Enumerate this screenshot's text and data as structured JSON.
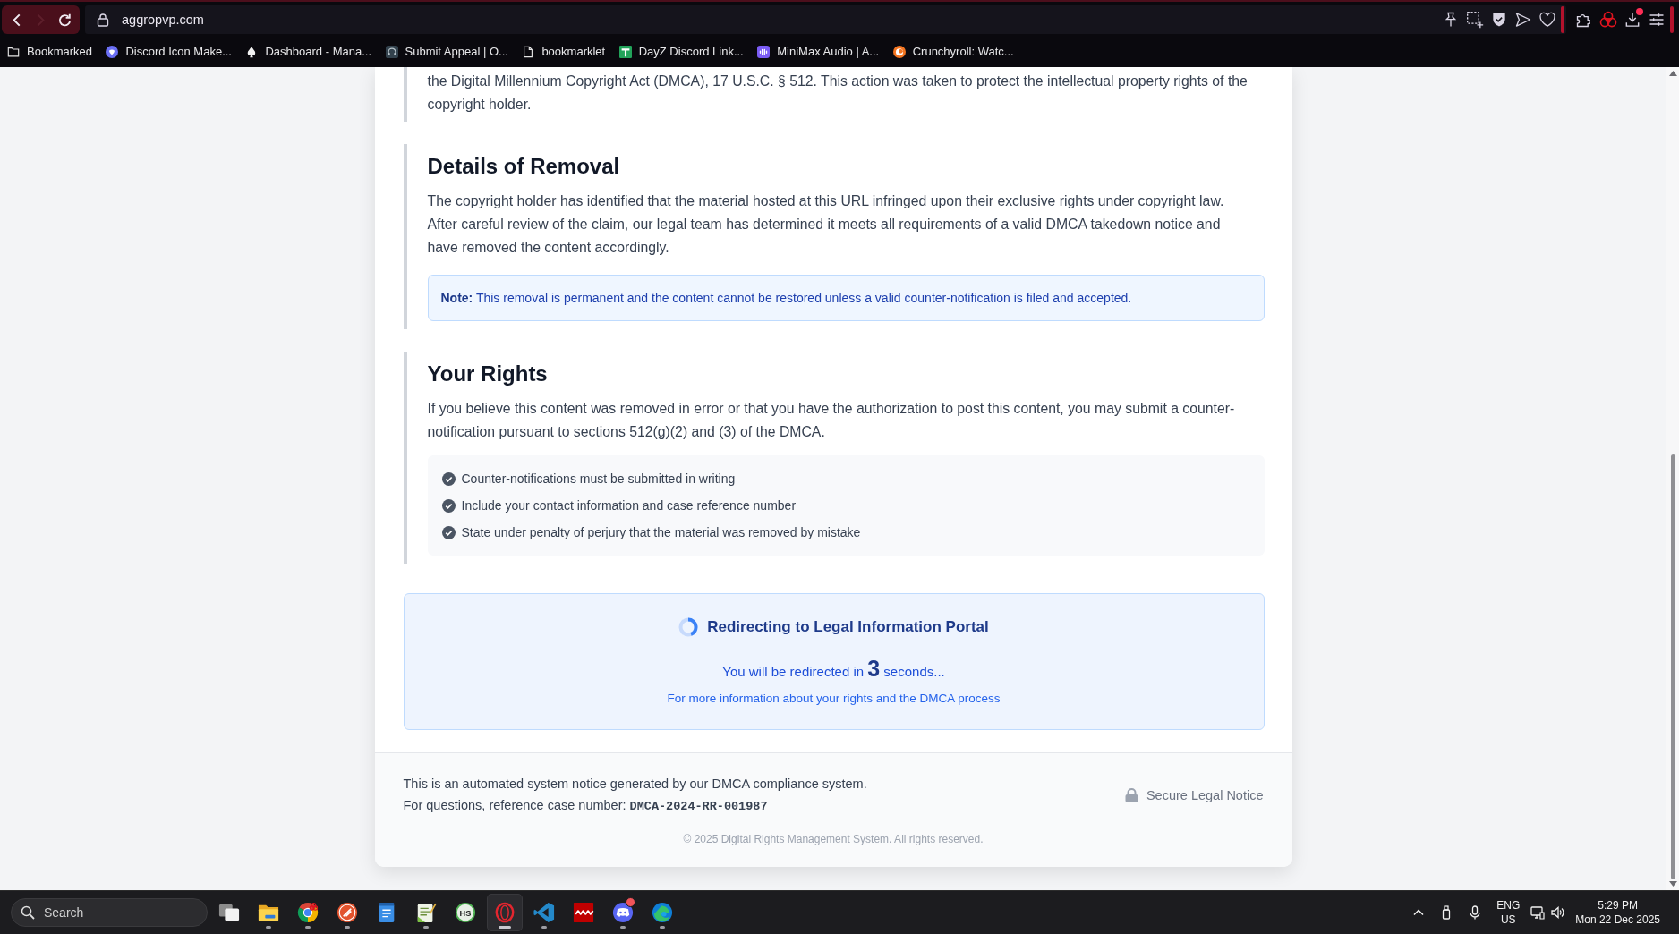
{
  "browser": {
    "nav": [
      {
        "kind": "back",
        "disabled": false
      },
      {
        "kind": "forward",
        "disabled": true
      },
      {
        "kind": "reload",
        "disabled": false
      }
    ],
    "url": "aggropvp.com",
    "download_badge": true,
    "bookmarks": [
      {
        "kind": "folder",
        "label": "Bookmarked"
      },
      {
        "kind": "disc",
        "label": "Discord Icon Make..."
      },
      {
        "kind": "spade",
        "label": "Dashboard - Mana..."
      },
      {
        "kind": "headset",
        "label": "Submit Appeal | O..."
      },
      {
        "kind": "page",
        "label": "bookmarklet"
      },
      {
        "kind": "cross-tile",
        "label": "DayZ Discord Link..."
      },
      {
        "kind": "wave-tile",
        "label": "MiniMax Audio | A..."
      },
      {
        "kind": "crescent-disc",
        "label": "Crunchyroll: Watc..."
      }
    ]
  },
  "notice": {
    "sections": [
      {
        "paragraphs": [
          "the Digital Millennium Copyright Act (DMCA), 17 U.S.C. § 512. This action was taken to protect the intellectual property rights of the copyright holder."
        ]
      },
      {
        "heading": "Details of Removal",
        "paragraphs": [
          "The copyright holder has identified that the material hosted at this URL infringed upon their exclusive rights under copyright law. After careful review of the claim, our legal team has determined it meets all requirements of a valid DMCA takedown notice and have removed the content accordingly."
        ],
        "note": "**Note:** This removal is permanent and the content cannot be restored unless a valid counter-notification is filed and accepted."
      },
      {
        "heading": "Your Rights",
        "paragraphs": [
          "If you believe this content was removed in error or that you have the authorization to post this content, you may submit a counter-notification pursuant to sections 512(g)(2) and (3) of the DMCA."
        ],
        "checklist": [
          "Counter-notifications must be submitted in writing",
          "Include your contact information and case reference number",
          "State under penalty of perjury that the material was removed by mistake"
        ]
      }
    ],
    "redirect": {
      "title": "Redirecting to Legal Information Portal",
      "countdown": "You will be redirected in **3** seconds...",
      "link": "For more information about your rights and the DMCA process"
    },
    "footer": {
      "notice": "This is an automated system notice generated by our DMCA compliance system.",
      "reference": "For questions, reference case number: **DMCA-2024-RR-001987**",
      "badge": "Secure Legal Notice",
      "copyright": "© 2025 Digital Rights Management System. All rights reserved."
    }
  },
  "taskbar": {
    "search_placeholder": "Search",
    "apps": [
      {
        "kind": "windows-stack",
        "running": false,
        "selected": false,
        "badge": false
      },
      {
        "kind": "folder",
        "running": true,
        "selected": false,
        "badge": false
      },
      {
        "kind": "segmented-ball",
        "running": true,
        "selected": false,
        "badge": false
      },
      {
        "kind": "slash-disc",
        "running": true,
        "selected": false,
        "badge": false
      },
      {
        "kind": "notepad",
        "running": false,
        "selected": false,
        "badge": false
      },
      {
        "kind": "document",
        "running": true,
        "selected": false,
        "badge": false
      },
      {
        "kind": "letter-badge",
        "glyph": "HS",
        "running": false,
        "selected": false,
        "badge": false
      },
      {
        "kind": "ring",
        "running": true,
        "selected": true,
        "badge": false
      },
      {
        "kind": "ribbon",
        "running": true,
        "selected": false,
        "badge": false
      },
      {
        "kind": "zigzag-tile",
        "running": false,
        "selected": false,
        "badge": false
      },
      {
        "kind": "controller-disc",
        "running": true,
        "selected": false,
        "badge": true
      },
      {
        "kind": "swirl",
        "running": true,
        "selected": false,
        "badge": false
      }
    ],
    "tray": {
      "language": "ENG",
      "region": "US",
      "time": "5:29 PM",
      "date": "Mon 22 Dec 2025"
    }
  }
}
